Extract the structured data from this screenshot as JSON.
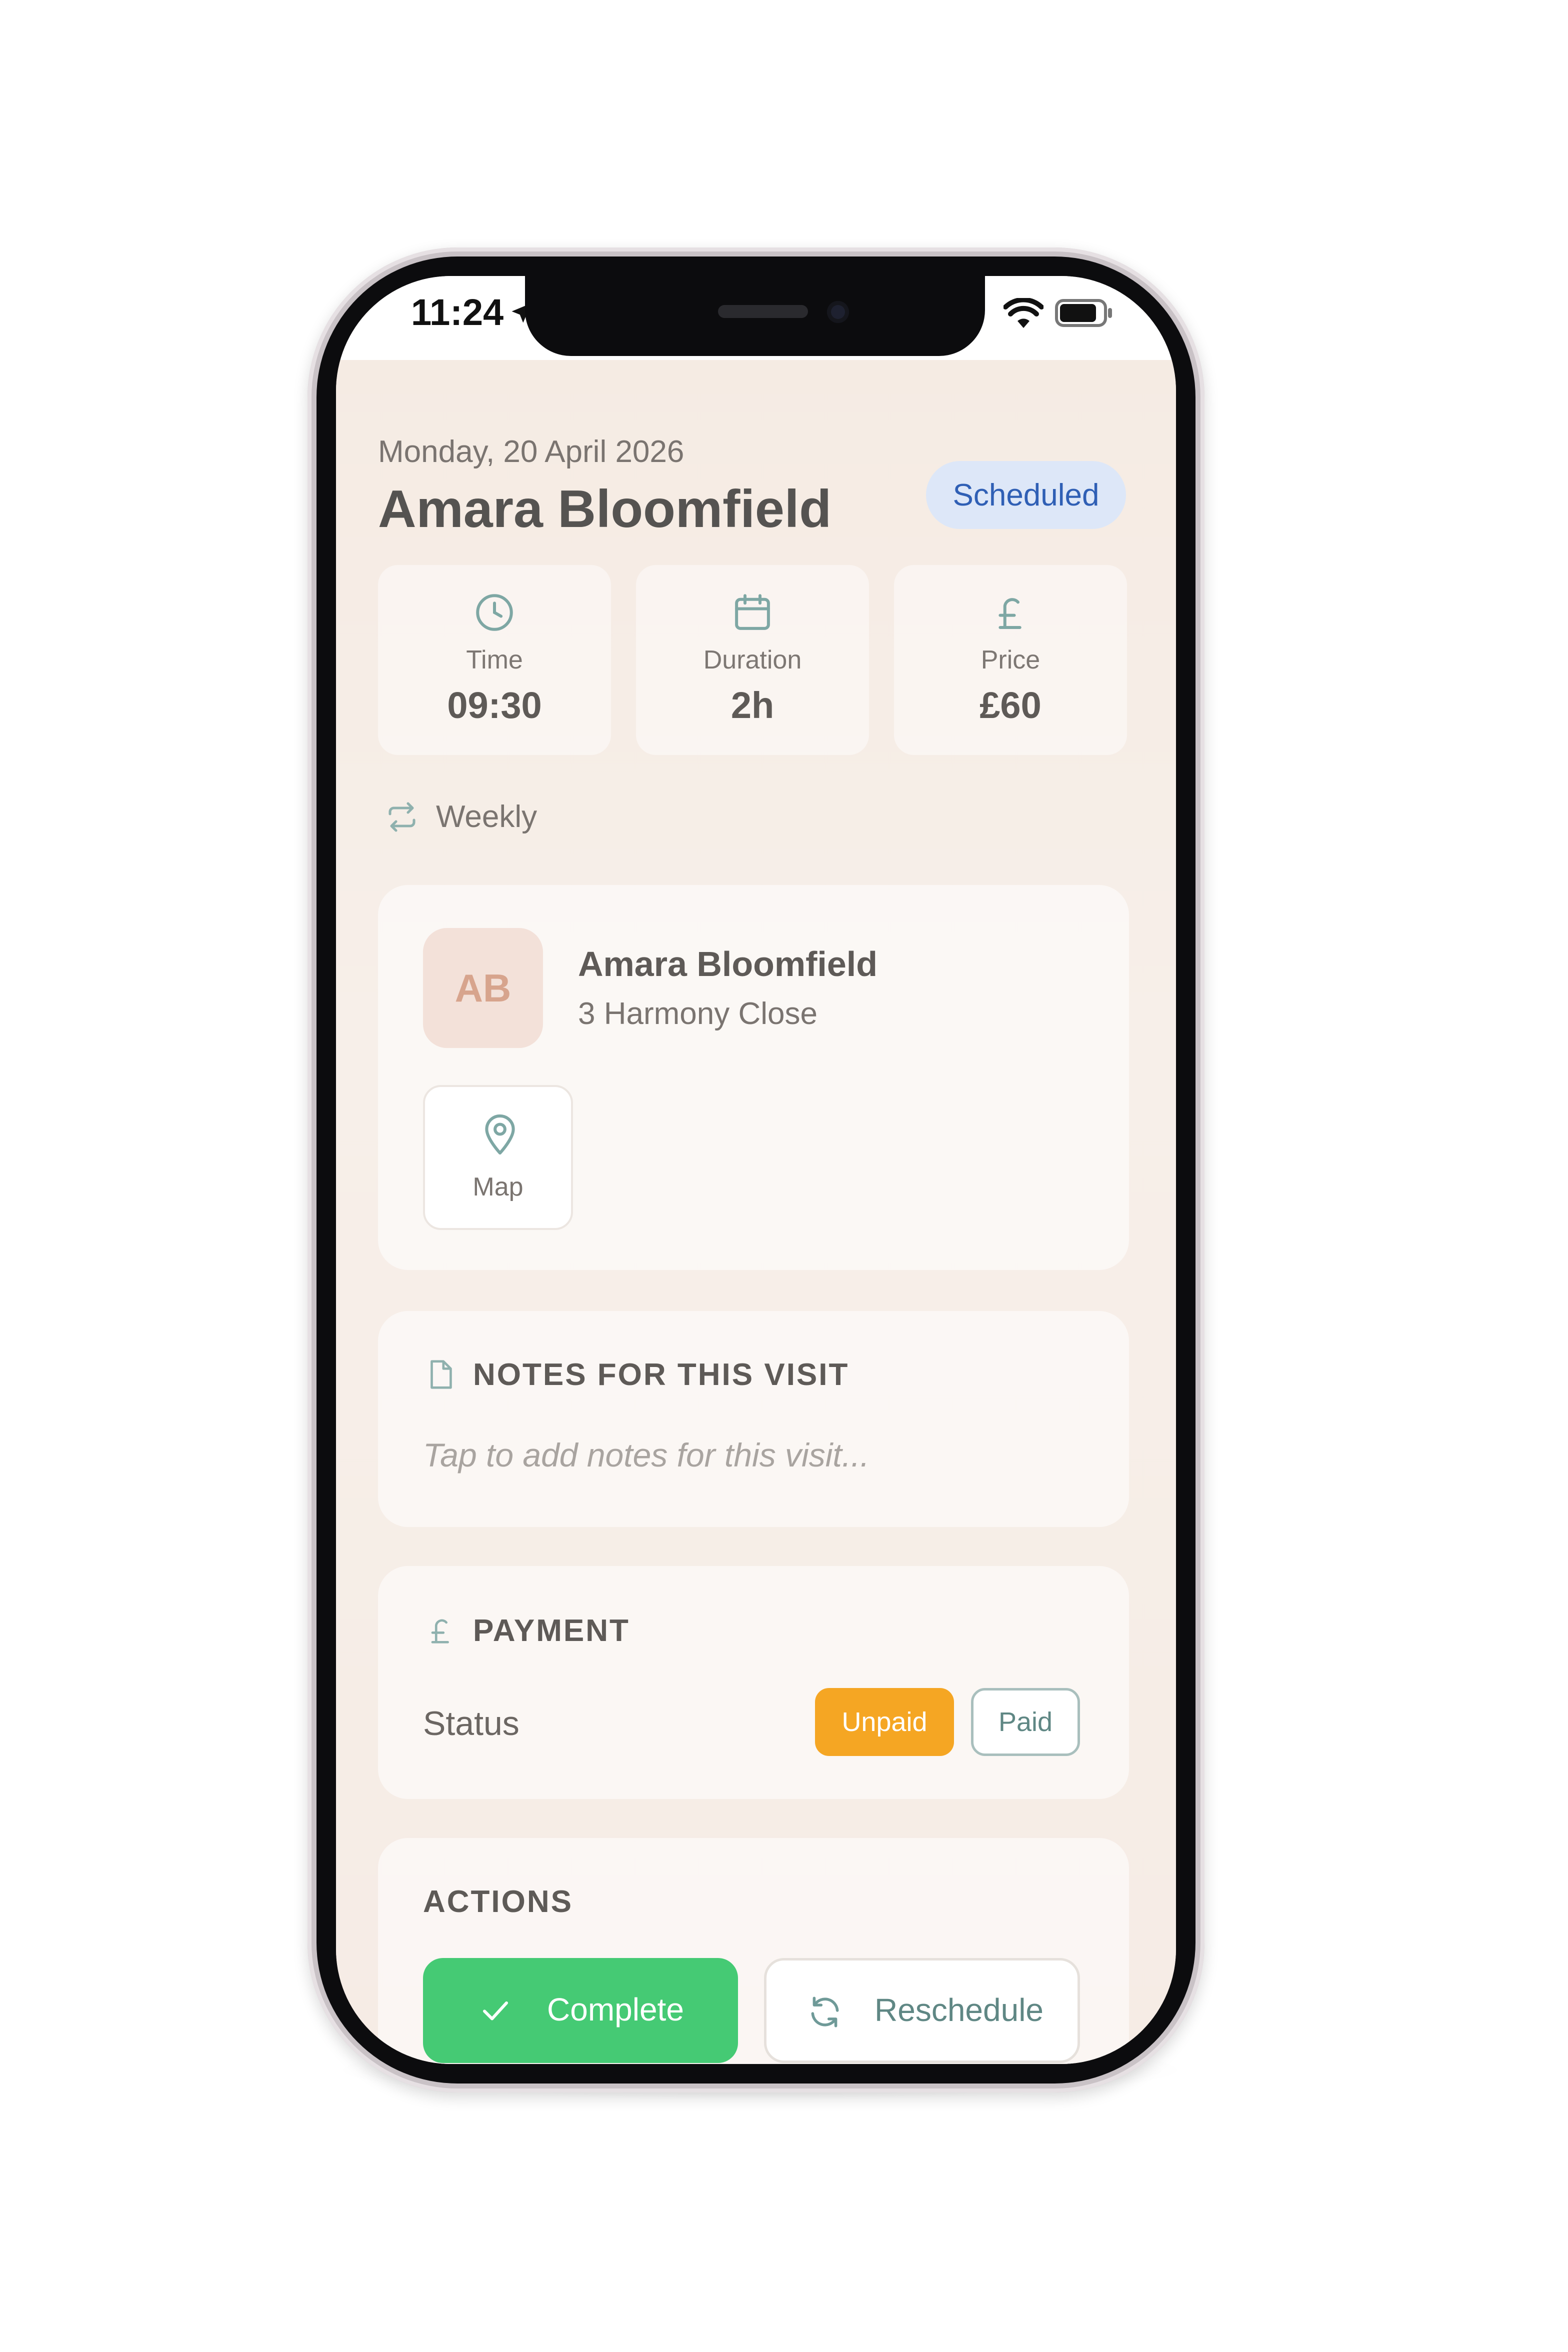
{
  "status_bar": {
    "time": "11:24",
    "icons": [
      "location-arrow-icon",
      "wifi-icon",
      "battery-icon"
    ]
  },
  "appointment": {
    "date": "Monday, 20 April 2026",
    "client_name": "Amara Bloomfield",
    "status": "Scheduled",
    "stats": [
      {
        "icon": "clock-icon",
        "label": "Time",
        "value": "09:30"
      },
      {
        "icon": "calendar-icon",
        "label": "Duration",
        "value": "2h"
      },
      {
        "icon": "pound-icon",
        "label": "Price",
        "value": "£60"
      }
    ],
    "frequency": {
      "icon": "repeat-icon",
      "label": "Weekly"
    }
  },
  "client_card": {
    "initials": "AB",
    "name": "Amara Bloomfield",
    "address": "3 Harmony Close",
    "map_button": {
      "icon": "map-pin-icon",
      "label": "Map"
    }
  },
  "notes": {
    "icon": "document-icon",
    "title": "NOTES FOR THIS VISIT",
    "placeholder": "Tap to add notes for this visit..."
  },
  "payment": {
    "icon": "pound-icon",
    "title": "PAYMENT",
    "status_label": "Status",
    "options": [
      "Unpaid",
      "Paid"
    ],
    "selected": "Unpaid"
  },
  "actions": {
    "title": "ACTIONS",
    "complete_label": "Complete",
    "reschedule_label": "Reschedule"
  },
  "colors": {
    "accent_teal": "#6f9a98",
    "scheduled_bg": "#dde7f8",
    "scheduled_text": "#2f5fb5",
    "unpaid": "#f5a623",
    "complete": "#45ca74",
    "background": "#f6ede7"
  }
}
